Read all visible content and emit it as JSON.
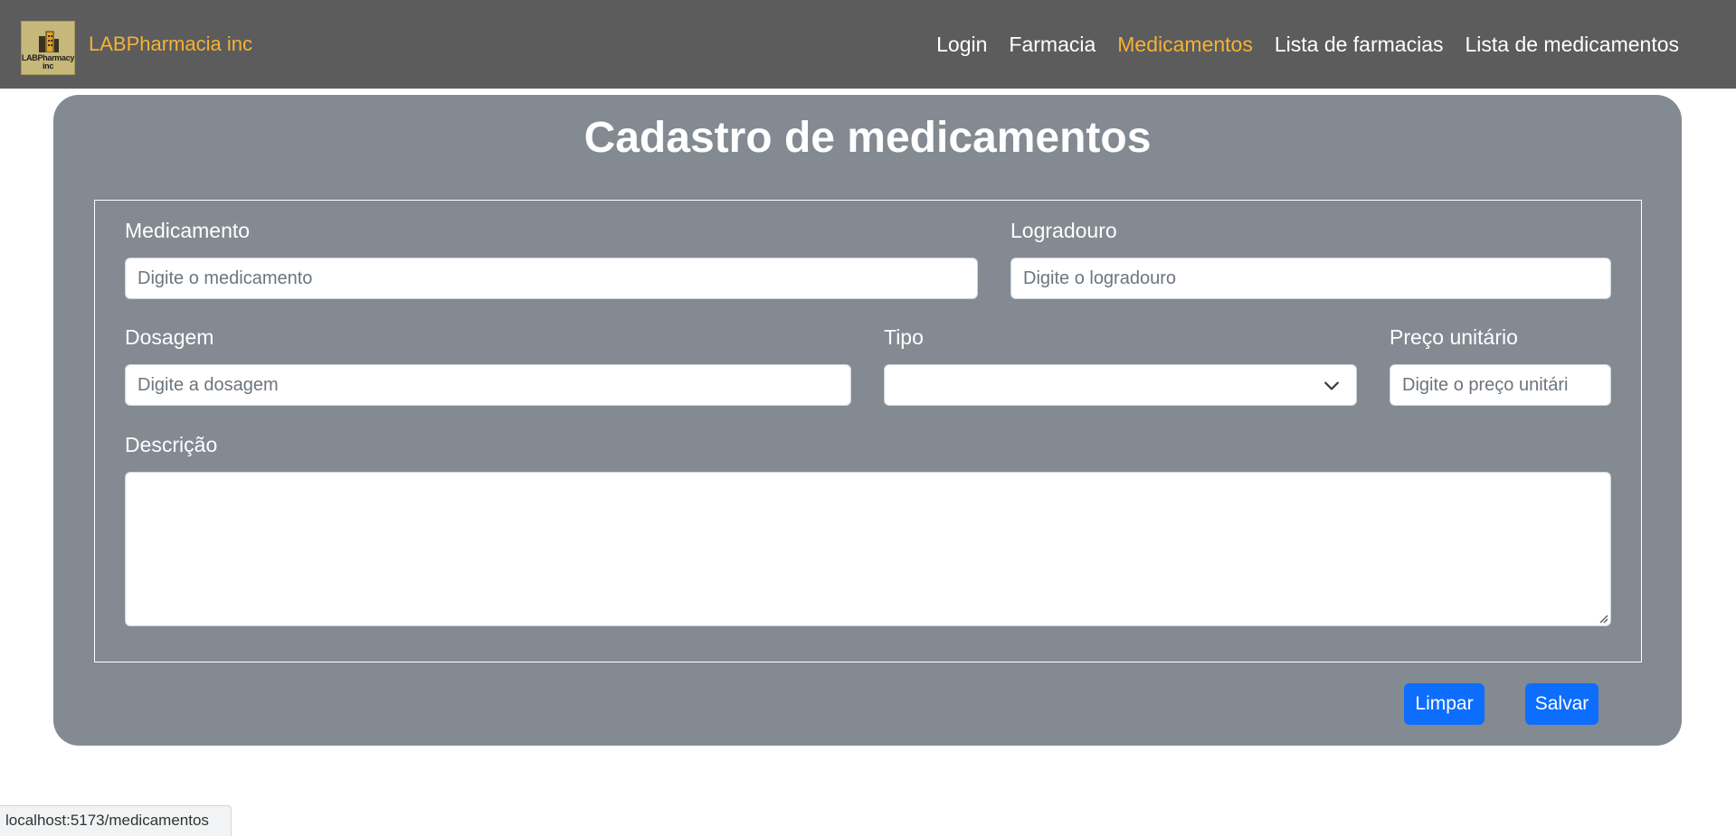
{
  "navbar": {
    "logo_text": "LABPharmacy inc",
    "brand": "LABPharmacia inc",
    "links": [
      {
        "label": "Login"
      },
      {
        "label": "Farmacia"
      },
      {
        "label": "Medicamentos",
        "active": true
      },
      {
        "label": "Lista de farmacias"
      },
      {
        "label": "Lista de medicamentos"
      }
    ],
    "colors": {
      "background": "#5c5c5c",
      "accent": "#f5b233"
    }
  },
  "form": {
    "title": "Cadastro de medicamentos",
    "medicamento": {
      "label": "Medicamento",
      "placeholder": "Digite o medicamento",
      "value": ""
    },
    "logradouro": {
      "label": "Logradouro",
      "placeholder": "Digite o logradouro",
      "value": ""
    },
    "dosagem": {
      "label": "Dosagem",
      "placeholder": "Digite a dosagem",
      "value": ""
    },
    "tipo": {
      "label": "Tipo",
      "selected": ""
    },
    "preco": {
      "label": "Preço unitário",
      "placeholder": "Digite o preço unitári",
      "value": ""
    },
    "descricao": {
      "label": "Descrição",
      "value": ""
    },
    "buttons": {
      "limpar": "Limpar",
      "salvar": "Salvar"
    },
    "colors": {
      "card": "#838a92",
      "button": "#0d6efd"
    }
  },
  "status_bar": {
    "url": "localhost:5173/medicamentos"
  }
}
